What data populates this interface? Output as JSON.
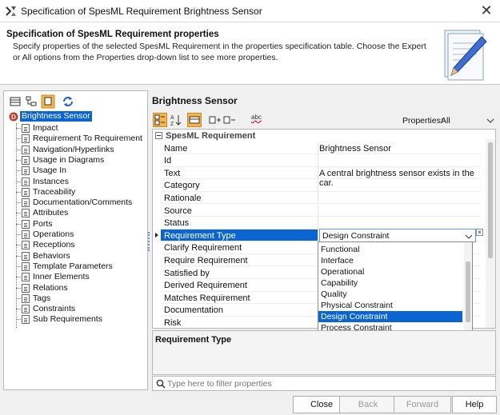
{
  "window": {
    "title": "Specification of SpesML Requirement Brightness Sensor",
    "close_glyph": "✕"
  },
  "header": {
    "title": "Specification of SpesML Requirement properties",
    "description": "Specify properties of the selected SpesML Requirement in the properties specification table. Choose the Expert or All options from the Properties drop-down list to see more properties."
  },
  "tree": {
    "root": {
      "label": "Brightness Sensor",
      "badge": "D"
    },
    "items": [
      "Impact",
      "Requirement To Requirement",
      "Navigation/Hyperlinks",
      "Usage in Diagrams",
      "Usage In",
      "Instances",
      "Traceability",
      "Documentation/Comments",
      "Attributes",
      "Ports",
      "Operations",
      "Receptions",
      "Behaviors",
      "Template Parameters",
      "Inner Elements",
      "Relations",
      "Tags",
      "Constraints",
      "Sub Requirements"
    ]
  },
  "right_panel": {
    "title": "Brightness Sensor",
    "properties_label": "Properties:",
    "properties_value": "All",
    "abc_label": "abc",
    "group_label": "SpesML Requirement",
    "rows": [
      {
        "name": "Name",
        "value": "Brightness Sensor"
      },
      {
        "name": "Id",
        "value": ""
      },
      {
        "name": "Text",
        "value": "A central brightness sensor exists in the car."
      },
      {
        "name": "Category",
        "value": ""
      },
      {
        "name": "Rationale",
        "value": ""
      },
      {
        "name": "Source",
        "value": ""
      },
      {
        "name": "Status",
        "value": ""
      },
      {
        "name": "Requirement Type",
        "value": "Design Constraint"
      },
      {
        "name": "Clarify Requirement",
        "value": ""
      },
      {
        "name": "Require Requirement",
        "value": ""
      },
      {
        "name": "Satisfied by",
        "value": ""
      },
      {
        "name": "Derived Requirement",
        "value": ""
      },
      {
        "name": "Matches Requirement",
        "value": ""
      },
      {
        "name": "Documentation",
        "value": ""
      },
      {
        "name": "Risk",
        "value": ""
      }
    ],
    "dropdown_options": [
      "Functional",
      "Interface",
      "Operational",
      "Capability",
      "Quality",
      "Physical Constraint",
      "Design Constraint",
      "Process Constraint"
    ],
    "dropdown_selected": "Design Constraint",
    "description_title": "Requirement Type",
    "filter_placeholder": "Type here to filter properties"
  },
  "buttons": {
    "close": "Close",
    "back": "Back",
    "forward": "Forward",
    "help": "Help"
  },
  "colors": {
    "selection": "#0a64d2",
    "accent_orange": "#f7b44a",
    "badge_red": "#c0392b"
  }
}
